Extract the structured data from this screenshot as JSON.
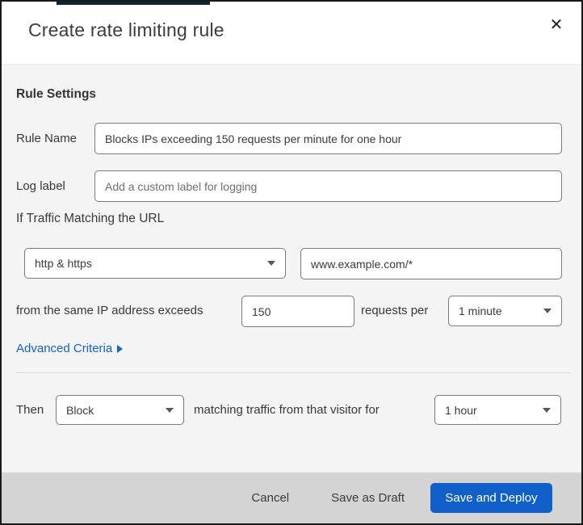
{
  "header": {
    "title": "Create rate limiting rule",
    "close_icon": "✕"
  },
  "rule_settings": {
    "heading": "Rule Settings",
    "rule_name": {
      "label": "Rule Name",
      "value": "Blocks IPs exceeding 150 requests per minute for one hour"
    },
    "log_label": {
      "label": "Log label",
      "placeholder": "Add a custom label for logging"
    }
  },
  "traffic_match": {
    "heading": "If Traffic Matching the URL",
    "scheme_select": {
      "value": "http & https",
      "icon": "caret-down"
    },
    "url_input": {
      "value": "www.example.com/*"
    },
    "threshold": {
      "prefix": "from the same IP address exceeds",
      "count_value": "150",
      "middle": "requests per",
      "period_select": {
        "value": "1 minute",
        "icon": "caret-down"
      }
    },
    "advanced_criteria": {
      "label": "Advanced Criteria",
      "icon": "triangle-right"
    }
  },
  "action": {
    "prefix": "Then",
    "action_select": {
      "value": "Block",
      "icon": "caret-down"
    },
    "middle": "matching traffic from that visitor for",
    "duration_select": {
      "value": "1 hour",
      "icon": "caret-down"
    }
  },
  "footer": {
    "cancel_label": "Cancel",
    "save_draft_label": "Save as Draft",
    "save_deploy_label": "Save and Deploy"
  },
  "colors": {
    "accent_blue": "#1263cd",
    "button_blue": "#1160ca",
    "peek_bar_navy": "#0e2437",
    "footer_gray": "#d4d4d4",
    "body_gray": "#f4f4f5"
  }
}
